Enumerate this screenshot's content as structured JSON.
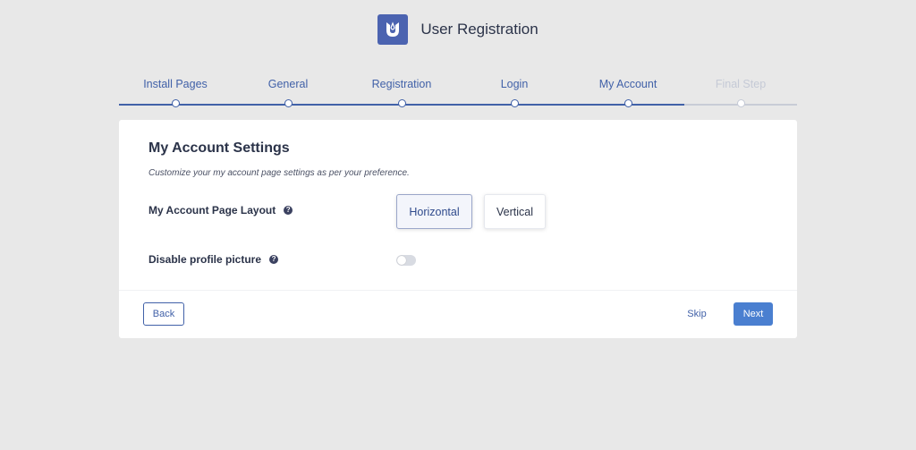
{
  "header": {
    "app_title": "User Registration",
    "logo_icon": "user-registration-logo-icon",
    "brand_color": "#4b63b0"
  },
  "stepper": {
    "active_color": "#4161a8",
    "pending_color": "#c5cad6",
    "steps": [
      {
        "label": "Install Pages",
        "state": "done"
      },
      {
        "label": "General",
        "state": "done"
      },
      {
        "label": "Registration",
        "state": "done"
      },
      {
        "label": "Login",
        "state": "done"
      },
      {
        "label": "My Account",
        "state": "current"
      },
      {
        "label": "Final Step",
        "state": "pending"
      }
    ]
  },
  "card": {
    "title": "My Account Settings",
    "description": "Customize your my account page settings as per your preference.",
    "layout_setting": {
      "label": "My Account Page Layout",
      "help_icon": "question-circle-icon",
      "options": [
        {
          "label": "Horizontal",
          "selected": true
        },
        {
          "label": "Vertical",
          "selected": false
        }
      ]
    },
    "profile_picture_setting": {
      "label": "Disable profile picture",
      "help_icon": "question-circle-icon",
      "enabled": false
    }
  },
  "footer": {
    "back_label": "Back",
    "skip_label": "Skip",
    "next_label": "Next",
    "next_color": "#4a7fd0"
  }
}
